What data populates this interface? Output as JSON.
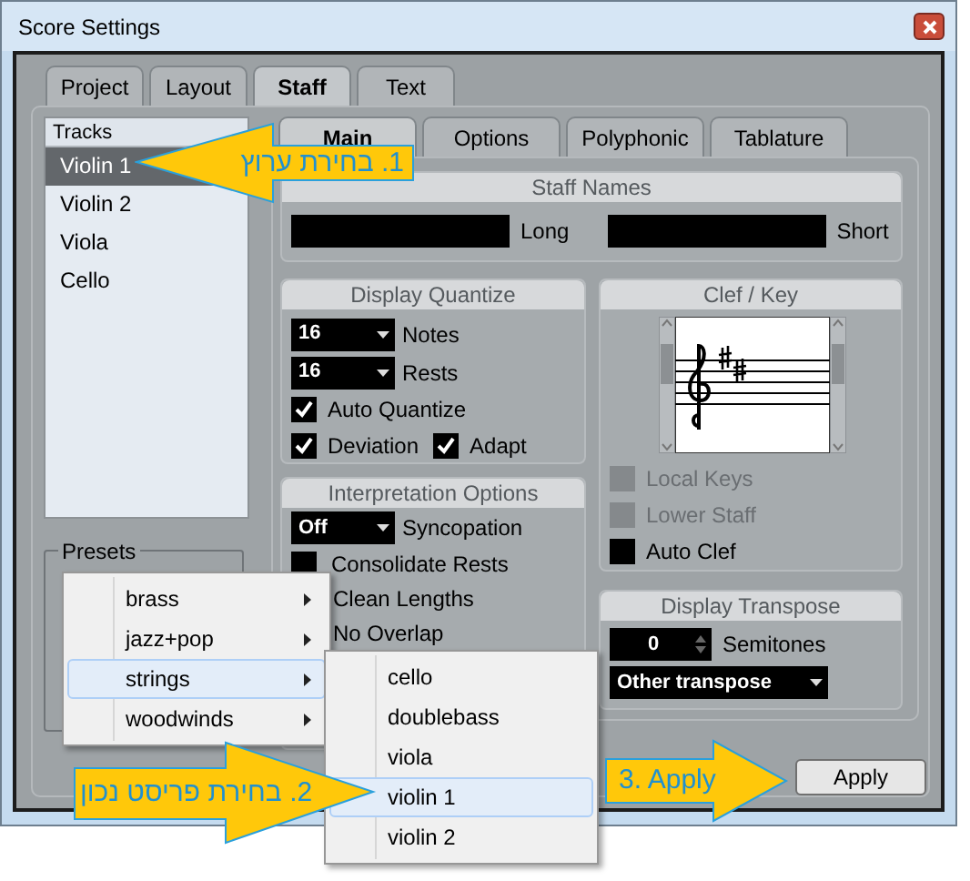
{
  "window": {
    "title": "Score Settings"
  },
  "tabs": [
    {
      "label": "Project",
      "selected": false
    },
    {
      "label": "Layout",
      "selected": false
    },
    {
      "label": "Staff",
      "selected": true
    },
    {
      "label": "Text",
      "selected": false
    }
  ],
  "tracks": {
    "header": "Tracks",
    "items": [
      {
        "label": "Violin 1",
        "selected": true
      },
      {
        "label": "Violin 2",
        "selected": false
      },
      {
        "label": "Viola",
        "selected": false
      },
      {
        "label": "Cello",
        "selected": false
      }
    ]
  },
  "presets": {
    "label": "Presets"
  },
  "subtabs": [
    {
      "label": "Main",
      "selected": true
    },
    {
      "label": "Options",
      "selected": false
    },
    {
      "label": "Polyphonic",
      "selected": false
    },
    {
      "label": "Tablature",
      "selected": false
    }
  ],
  "staff_names": {
    "title": "Staff Names",
    "fields": [
      {
        "label": "Long"
      },
      {
        "label": "Short"
      }
    ]
  },
  "display_quantize": {
    "title": "Display Quantize",
    "dropdowns": [
      {
        "value": "16",
        "label": "Notes"
      },
      {
        "value": "16",
        "label": "Rests"
      }
    ],
    "checks": [
      {
        "label": "Auto Quantize",
        "checked": true
      },
      {
        "label": "Deviation",
        "checked": true
      },
      {
        "label": "Adapt",
        "checked": true
      }
    ]
  },
  "interpretation": {
    "title": "Interpretation Options",
    "dropdown": {
      "value": "Off",
      "label": "Syncopation"
    },
    "checks": [
      {
        "label": "Consolidate Rests",
        "checked": false
      }
    ],
    "covered_labels": [
      "Clean Lengths",
      "No Overlap"
    ]
  },
  "clef_key": {
    "title": "Clef / Key",
    "checks": [
      {
        "label": "Local Keys",
        "checked": false,
        "disabled": true
      },
      {
        "label": "Lower Staff",
        "checked": false,
        "disabled": true
      },
      {
        "label": "Auto Clef",
        "checked": false,
        "disabled": false
      }
    ]
  },
  "display_transpose": {
    "title": "Display Transpose",
    "semitones": {
      "value": "0",
      "label": "Semitones"
    },
    "dropdown": {
      "value": "Other transpose"
    }
  },
  "apply_button": "Apply",
  "menu": {
    "items": [
      {
        "label": "brass",
        "selected": false
      },
      {
        "label": "jazz+pop",
        "selected": false
      },
      {
        "label": "strings",
        "selected": true
      },
      {
        "label": "woodwinds",
        "selected": false
      }
    ]
  },
  "submenu": {
    "items": [
      {
        "label": "cello",
        "selected": false
      },
      {
        "label": "doublebass",
        "selected": false
      },
      {
        "label": "viola",
        "selected": false
      },
      {
        "label": "violin 1",
        "selected": true
      },
      {
        "label": "violin 2",
        "selected": false
      }
    ]
  },
  "callouts": [
    {
      "text": "1. בחירת ערוץ",
      "kind": "left"
    },
    {
      "text": "2. בחירת פריסט נכון",
      "kind": "right"
    },
    {
      "text": "3. Apply",
      "kind": "right"
    }
  ]
}
